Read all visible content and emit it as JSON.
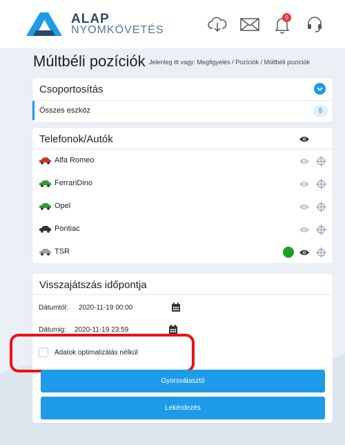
{
  "header": {
    "logo_line1": "ALAP",
    "logo_line2": "NYOMKÖVETÉS",
    "notification_count": "0",
    "icons": [
      "cloud-download-icon",
      "envelope-icon",
      "bell-icon",
      "headset-icon"
    ]
  },
  "page": {
    "title": "Múltbéli pozíciók",
    "breadcrumb": "Jelenleg itt vagy: Megfigyelés / Pozíciók / Múltbéli pozíciók"
  },
  "grouping": {
    "title": "Csoportosítás",
    "item_label": "Összes eszköz",
    "item_count": "5"
  },
  "vehicles": {
    "title": "Telefonok/Autók",
    "items": [
      {
        "name": "Alfa Romeo",
        "car_color": "#d32f2f",
        "online": false
      },
      {
        "name": "FerrariDino",
        "car_color": "#2e9d3a",
        "online": false
      },
      {
        "name": "Opel",
        "car_color": "#2e9d3a",
        "online": false
      },
      {
        "name": "Pontiac",
        "car_color": "#333333",
        "online": false
      },
      {
        "name": "TSR",
        "car_color": "#9aa3ad",
        "online": true
      }
    ]
  },
  "playback": {
    "title": "Visszajátszás időpontja",
    "from_label": "Dátumtól:",
    "from_value": "2020-11-19 00:00",
    "to_label": "Dátumig:",
    "to_value": "2020-11-19 23:59",
    "checkbox_label": "Adatok optimalizálás nélkül",
    "checkbox_checked": false,
    "quick_button": "Gyorsválasztó",
    "query_button": "Lekérdezés"
  },
  "colors": {
    "accent": "#1e9be8",
    "online": "#1aa11a",
    "highlight": "#ee1111"
  }
}
